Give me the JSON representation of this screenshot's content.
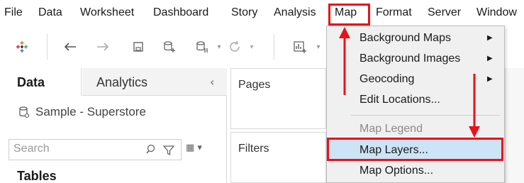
{
  "menubar": {
    "items": [
      "File",
      "Data",
      "Worksheet",
      "Dashboard",
      "Story",
      "Analysis",
      "Map",
      "Format",
      "Server",
      "Window"
    ]
  },
  "toolbar": {
    "icons": [
      "tableau-logo-icon",
      "undo-icon",
      "redo-icon",
      "save-icon",
      "add-data-source-icon",
      "pause-updates-icon",
      "refresh-icon",
      "new-worksheet-icon"
    ]
  },
  "left_panel": {
    "tabs": [
      {
        "label": "Data",
        "active": true
      },
      {
        "label": "Analytics",
        "active": false
      }
    ],
    "collapse_icon": "chevron-left-icon",
    "data_source": "Sample - Superstore",
    "search": {
      "placeholder": "Search"
    },
    "tables_heading": "Tables"
  },
  "shelves": {
    "pages_label": "Pages",
    "filters_label": "Filters"
  },
  "map_menu": {
    "items": [
      {
        "label": "Background Maps",
        "submenu": true,
        "disabled": false
      },
      {
        "label": "Background Images",
        "submenu": true,
        "disabled": false
      },
      {
        "label": "Geocoding",
        "submenu": true,
        "disabled": false
      },
      {
        "label": "Edit Locations...",
        "submenu": false,
        "disabled": false
      },
      {
        "label": "Map Legend",
        "submenu": false,
        "disabled": true
      },
      {
        "label": "Map Layers...",
        "submenu": false,
        "disabled": false,
        "highlighted": true
      },
      {
        "label": "Map Options...",
        "submenu": false,
        "disabled": false
      }
    ]
  },
  "annotation": {
    "color": "#e8121a",
    "highlight_color": "#cde4f7"
  }
}
